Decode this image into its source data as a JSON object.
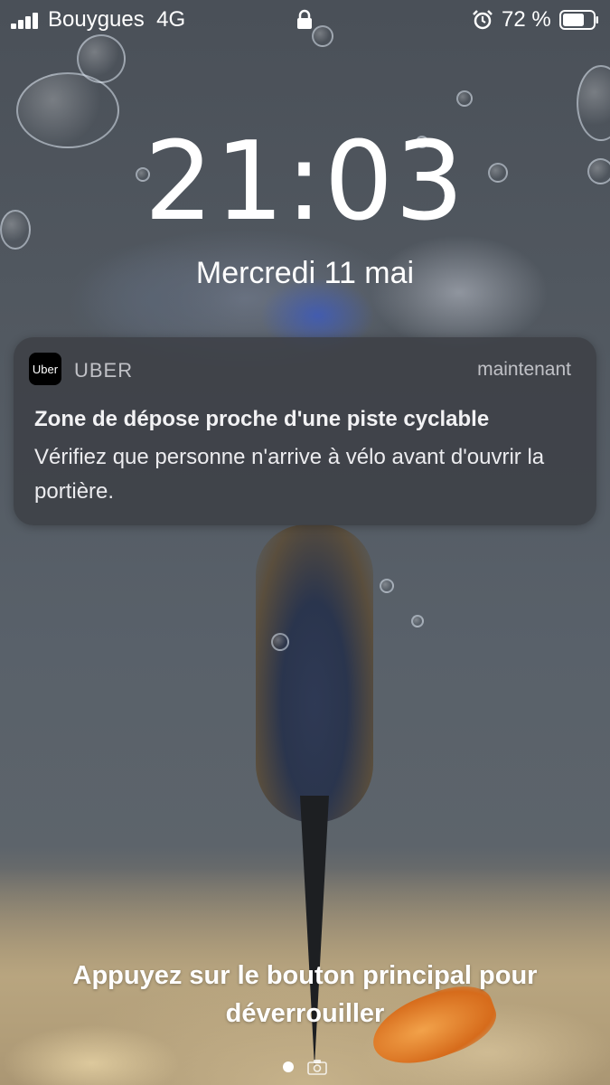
{
  "status_bar": {
    "carrier": "Bouygues",
    "network": "4G",
    "battery_percent": "72 %",
    "battery_level": 0.72,
    "icons": [
      "signal-icon",
      "lock-icon",
      "alarm-icon",
      "battery-icon"
    ]
  },
  "lock_screen": {
    "time": "21:03",
    "date": "Mercredi 11 mai"
  },
  "notification": {
    "app_icon_text": "Uber",
    "app_name": "UBER",
    "time": "maintenant",
    "title": "Zone de dépose proche d'une piste cyclable",
    "body": "Vérifiez que personne n'arrive à vélo avant d'ouvrir la portière."
  },
  "unlock_hint": "Appuyez sur le bouton principal pour déverrouiller",
  "colors": {
    "notification_bg": "#3c3e44",
    "text": "#ffffff",
    "app_icon_bg": "#000000"
  }
}
